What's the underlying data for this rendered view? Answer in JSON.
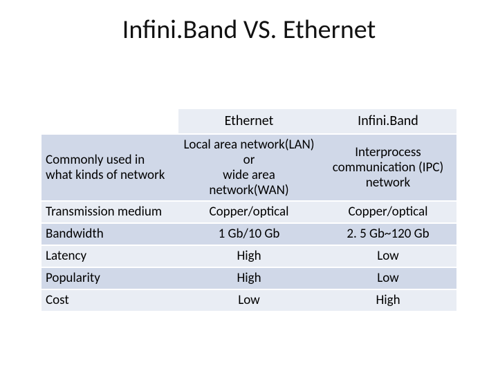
{
  "title": "Infini.Band VS. Ethernet",
  "columns": {
    "label": "",
    "a": "Ethernet",
    "b": "Infini.Band"
  },
  "rows": [
    {
      "label": "Commonly used in what kinds of network",
      "a_l1": "Local area network(LAN)",
      "a_l2": "or",
      "a_l3": "wide area network(WAN)",
      "b_l1": "Interprocess",
      "b_l2": "communication (IPC)",
      "b_l3": "network"
    },
    {
      "label": "Transmission medium",
      "a": "Copper/optical",
      "b": "Copper/optical"
    },
    {
      "label": "Bandwidth",
      "a": "1 Gb/10 Gb",
      "b": "2. 5 Gb~120 Gb"
    },
    {
      "label": "Latency",
      "a": "High",
      "b": "Low"
    },
    {
      "label": "Popularity",
      "a": "High",
      "b": "Low"
    },
    {
      "label": "Cost",
      "a": "Low",
      "b": "High"
    }
  ],
  "chart_data": {
    "type": "table",
    "title": "Infini.Band VS. Ethernet",
    "columns": [
      "",
      "Ethernet",
      "Infini.Band"
    ],
    "rows": [
      [
        "Commonly used in what kinds of network",
        "Local area network(LAN) or wide area network(WAN)",
        "Interprocess communication (IPC) network"
      ],
      [
        "Transmission medium",
        "Copper/optical",
        "Copper/optical"
      ],
      [
        "Bandwidth",
        "1 Gb/10 Gb",
        "2. 5 Gb~120 Gb"
      ],
      [
        "Latency",
        "High",
        "Low"
      ],
      [
        "Popularity",
        "High",
        "Low"
      ],
      [
        "Cost",
        "Low",
        "High"
      ]
    ]
  }
}
